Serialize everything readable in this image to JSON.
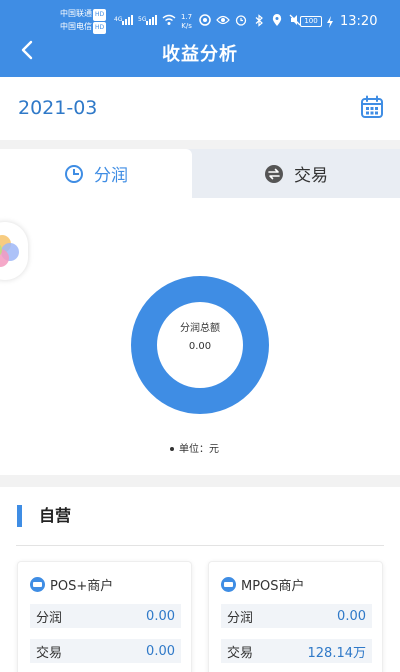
{
  "status_bar": {
    "carrier1": "中国联通",
    "carrier2": "中国电信",
    "hd": "HD",
    "net1": "4G",
    "net2": "5G",
    "speed_value": "1.7",
    "speed_unit": "K/s",
    "battery": "100",
    "time": "13:20"
  },
  "header": {
    "title": "收益分析"
  },
  "date_bar": {
    "date": "2021-03"
  },
  "tabs": [
    {
      "label": "分润",
      "icon": "pie-chart-icon",
      "active": true
    },
    {
      "label": "交易",
      "icon": "exchange-icon",
      "active": false
    }
  ],
  "chart_data": {
    "type": "pie",
    "center_label": "分润总额",
    "center_value": "0.00",
    "unit_legend": "单位：元",
    "color": "#3f8de4"
  },
  "section": {
    "title": "自营",
    "cards": [
      {
        "name": "POS+商户",
        "rows": [
          {
            "label": "分润",
            "value": "0.00"
          },
          {
            "label": "交易",
            "value": "0.00"
          }
        ]
      },
      {
        "name": "MPOS商户",
        "rows": [
          {
            "label": "分润",
            "value": "0.00"
          },
          {
            "label": "交易",
            "value": "128.14万"
          }
        ]
      }
    ]
  },
  "colors": {
    "primary": "#3f8de4",
    "value_text": "#2f79c8"
  }
}
